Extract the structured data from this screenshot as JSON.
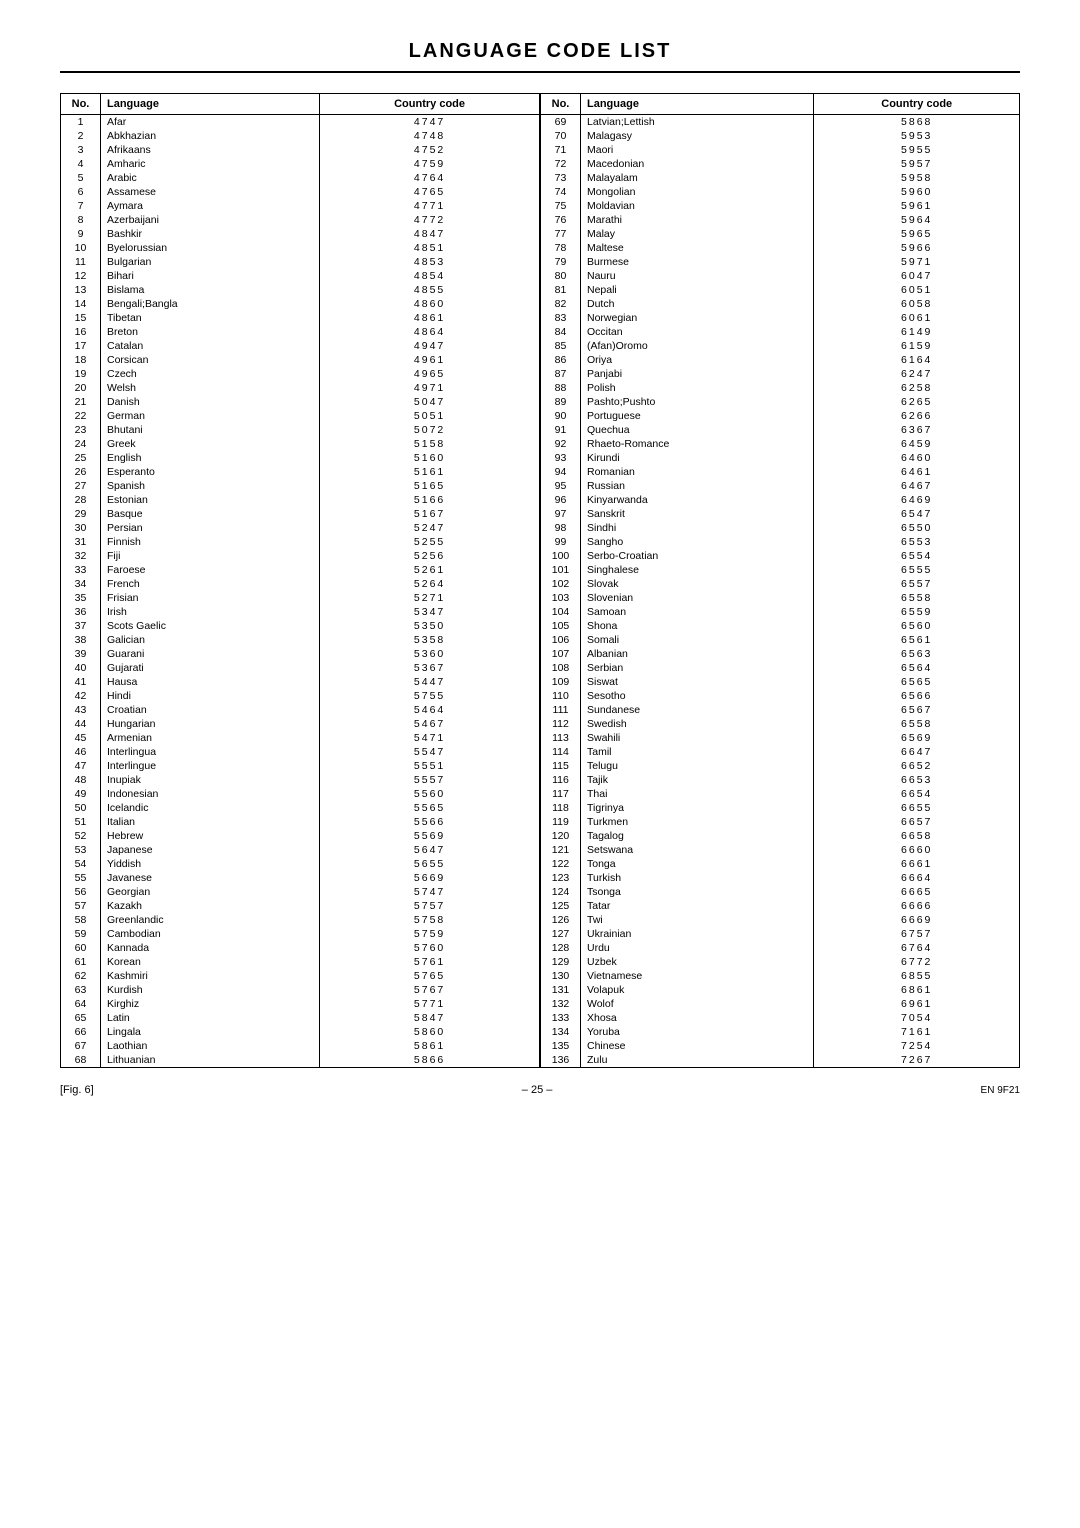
{
  "title": "LANGUAGE CODE LIST",
  "left_table": {
    "headers": [
      "No.",
      "Language",
      "Country code"
    ],
    "rows": [
      [
        1,
        "Afar",
        "4747"
      ],
      [
        2,
        "Abkhazian",
        "4748"
      ],
      [
        3,
        "Afrikaans",
        "4752"
      ],
      [
        4,
        "Amharic",
        "4759"
      ],
      [
        5,
        "Arabic",
        "4764"
      ],
      [
        6,
        "Assamese",
        "4765"
      ],
      [
        7,
        "Aymara",
        "4771"
      ],
      [
        8,
        "Azerbaijani",
        "4772"
      ],
      [
        9,
        "Bashkir",
        "4847"
      ],
      [
        10,
        "Byelorussian",
        "4851"
      ],
      [
        11,
        "Bulgarian",
        "4853"
      ],
      [
        12,
        "Bihari",
        "4854"
      ],
      [
        13,
        "Bislama",
        "4855"
      ],
      [
        14,
        "Bengali;Bangla",
        "4860"
      ],
      [
        15,
        "Tibetan",
        "4861"
      ],
      [
        16,
        "Breton",
        "4864"
      ],
      [
        17,
        "Catalan",
        "4947"
      ],
      [
        18,
        "Corsican",
        "4961"
      ],
      [
        19,
        "Czech",
        "4965"
      ],
      [
        20,
        "Welsh",
        "4971"
      ],
      [
        21,
        "Danish",
        "5047"
      ],
      [
        22,
        "German",
        "5051"
      ],
      [
        23,
        "Bhutani",
        "5072"
      ],
      [
        24,
        "Greek",
        "5158"
      ],
      [
        25,
        "English",
        "5160"
      ],
      [
        26,
        "Esperanto",
        "5161"
      ],
      [
        27,
        "Spanish",
        "5165"
      ],
      [
        28,
        "Estonian",
        "5166"
      ],
      [
        29,
        "Basque",
        "5167"
      ],
      [
        30,
        "Persian",
        "5247"
      ],
      [
        31,
        "Finnish",
        "5255"
      ],
      [
        32,
        "Fiji",
        "5256"
      ],
      [
        33,
        "Faroese",
        "5261"
      ],
      [
        34,
        "French",
        "5264"
      ],
      [
        35,
        "Frisian",
        "5271"
      ],
      [
        36,
        "Irish",
        "5347"
      ],
      [
        37,
        "Scots Gaelic",
        "5350"
      ],
      [
        38,
        "Galician",
        "5358"
      ],
      [
        39,
        "Guarani",
        "5360"
      ],
      [
        40,
        "Gujarati",
        "5367"
      ],
      [
        41,
        "Hausa",
        "5447"
      ],
      [
        42,
        "Hindi",
        "5755"
      ],
      [
        43,
        "Croatian",
        "5464"
      ],
      [
        44,
        "Hungarian",
        "5467"
      ],
      [
        45,
        "Armenian",
        "5471"
      ],
      [
        46,
        "Interlingua",
        "5547"
      ],
      [
        47,
        "Interlingue",
        "5551"
      ],
      [
        48,
        "Inupiak",
        "5557"
      ],
      [
        49,
        "Indonesian",
        "5560"
      ],
      [
        50,
        "Icelandic",
        "5565"
      ],
      [
        51,
        "Italian",
        "5566"
      ],
      [
        52,
        "Hebrew",
        "5569"
      ],
      [
        53,
        "Japanese",
        "5647"
      ],
      [
        54,
        "Yiddish",
        "5655"
      ],
      [
        55,
        "Javanese",
        "5669"
      ],
      [
        56,
        "Georgian",
        "5747"
      ],
      [
        57,
        "Kazakh",
        "5757"
      ],
      [
        58,
        "Greenlandic",
        "5758"
      ],
      [
        59,
        "Cambodian",
        "5759"
      ],
      [
        60,
        "Kannada",
        "5760"
      ],
      [
        61,
        "Korean",
        "5761"
      ],
      [
        62,
        "Kashmiri",
        "5765"
      ],
      [
        63,
        "Kurdish",
        "5767"
      ],
      [
        64,
        "Kirghiz",
        "5771"
      ],
      [
        65,
        "Latin",
        "5847"
      ],
      [
        66,
        "Lingala",
        "5860"
      ],
      [
        67,
        "Laothian",
        "5861"
      ],
      [
        68,
        "Lithuanian",
        "5866"
      ]
    ]
  },
  "right_table": {
    "headers": [
      "No.",
      "Language",
      "Country code"
    ],
    "rows": [
      [
        69,
        "Latvian;Lettish",
        "5868"
      ],
      [
        70,
        "Malagasy",
        "5953"
      ],
      [
        71,
        "Maori",
        "5955"
      ],
      [
        72,
        "Macedonian",
        "5957"
      ],
      [
        73,
        "Malayalam",
        "5958"
      ],
      [
        74,
        "Mongolian",
        "5960"
      ],
      [
        75,
        "Moldavian",
        "5961"
      ],
      [
        76,
        "Marathi",
        "5964"
      ],
      [
        77,
        "Malay",
        "5965"
      ],
      [
        78,
        "Maltese",
        "5966"
      ],
      [
        79,
        "Burmese",
        "5971"
      ],
      [
        80,
        "Nauru",
        "6047"
      ],
      [
        81,
        "Nepali",
        "6051"
      ],
      [
        82,
        "Dutch",
        "6058"
      ],
      [
        83,
        "Norwegian",
        "6061"
      ],
      [
        84,
        "Occitan",
        "6149"
      ],
      [
        85,
        "(Afan)Oromo",
        "6159"
      ],
      [
        86,
        "Oriya",
        "6164"
      ],
      [
        87,
        "Panjabi",
        "6247"
      ],
      [
        88,
        "Polish",
        "6258"
      ],
      [
        89,
        "Pashto;Pushto",
        "6265"
      ],
      [
        90,
        "Portuguese",
        "6266"
      ],
      [
        91,
        "Quechua",
        "6367"
      ],
      [
        92,
        "Rhaeto-Romance",
        "6459"
      ],
      [
        93,
        "Kirundi",
        "6460"
      ],
      [
        94,
        "Romanian",
        "6461"
      ],
      [
        95,
        "Russian",
        "6467"
      ],
      [
        96,
        "Kinyarwanda",
        "6469"
      ],
      [
        97,
        "Sanskrit",
        "6547"
      ],
      [
        98,
        "Sindhi",
        "6550"
      ],
      [
        99,
        "Sangho",
        "6553"
      ],
      [
        100,
        "Serbo-Croatian",
        "6554"
      ],
      [
        101,
        "Singhalese",
        "6555"
      ],
      [
        102,
        "Slovak",
        "6557"
      ],
      [
        103,
        "Slovenian",
        "6558"
      ],
      [
        104,
        "Samoan",
        "6559"
      ],
      [
        105,
        "Shona",
        "6560"
      ],
      [
        106,
        "Somali",
        "6561"
      ],
      [
        107,
        "Albanian",
        "6563"
      ],
      [
        108,
        "Serbian",
        "6564"
      ],
      [
        109,
        "Siswat",
        "6565"
      ],
      [
        110,
        "Sesotho",
        "6566"
      ],
      [
        111,
        "Sundanese",
        "6567"
      ],
      [
        112,
        "Swedish",
        "6558"
      ],
      [
        113,
        "Swahili",
        "6569"
      ],
      [
        114,
        "Tamil",
        "6647"
      ],
      [
        115,
        "Telugu",
        "6652"
      ],
      [
        116,
        "Tajik",
        "6653"
      ],
      [
        117,
        "Thai",
        "6654"
      ],
      [
        118,
        "Tigrinya",
        "6655"
      ],
      [
        119,
        "Turkmen",
        "6657"
      ],
      [
        120,
        "Tagalog",
        "6658"
      ],
      [
        121,
        "Setswana",
        "6660"
      ],
      [
        122,
        "Tonga",
        "6661"
      ],
      [
        123,
        "Turkish",
        "6664"
      ],
      [
        124,
        "Tsonga",
        "6665"
      ],
      [
        125,
        "Tatar",
        "6666"
      ],
      [
        126,
        "Twi",
        "6669"
      ],
      [
        127,
        "Ukrainian",
        "6757"
      ],
      [
        128,
        "Urdu",
        "6764"
      ],
      [
        129,
        "Uzbek",
        "6772"
      ],
      [
        130,
        "Vietnamese",
        "6855"
      ],
      [
        131,
        "Volapuk",
        "6861"
      ],
      [
        132,
        "Wolof",
        "6961"
      ],
      [
        133,
        "Xhosa",
        "7054"
      ],
      [
        134,
        "Yoruba",
        "7161"
      ],
      [
        135,
        "Chinese",
        "7254"
      ],
      [
        136,
        "Zulu",
        "7267"
      ]
    ]
  },
  "footer": {
    "fig_label": "[Fig. 6]",
    "page": "– 25 –",
    "page_info": "EN\n9F21"
  }
}
